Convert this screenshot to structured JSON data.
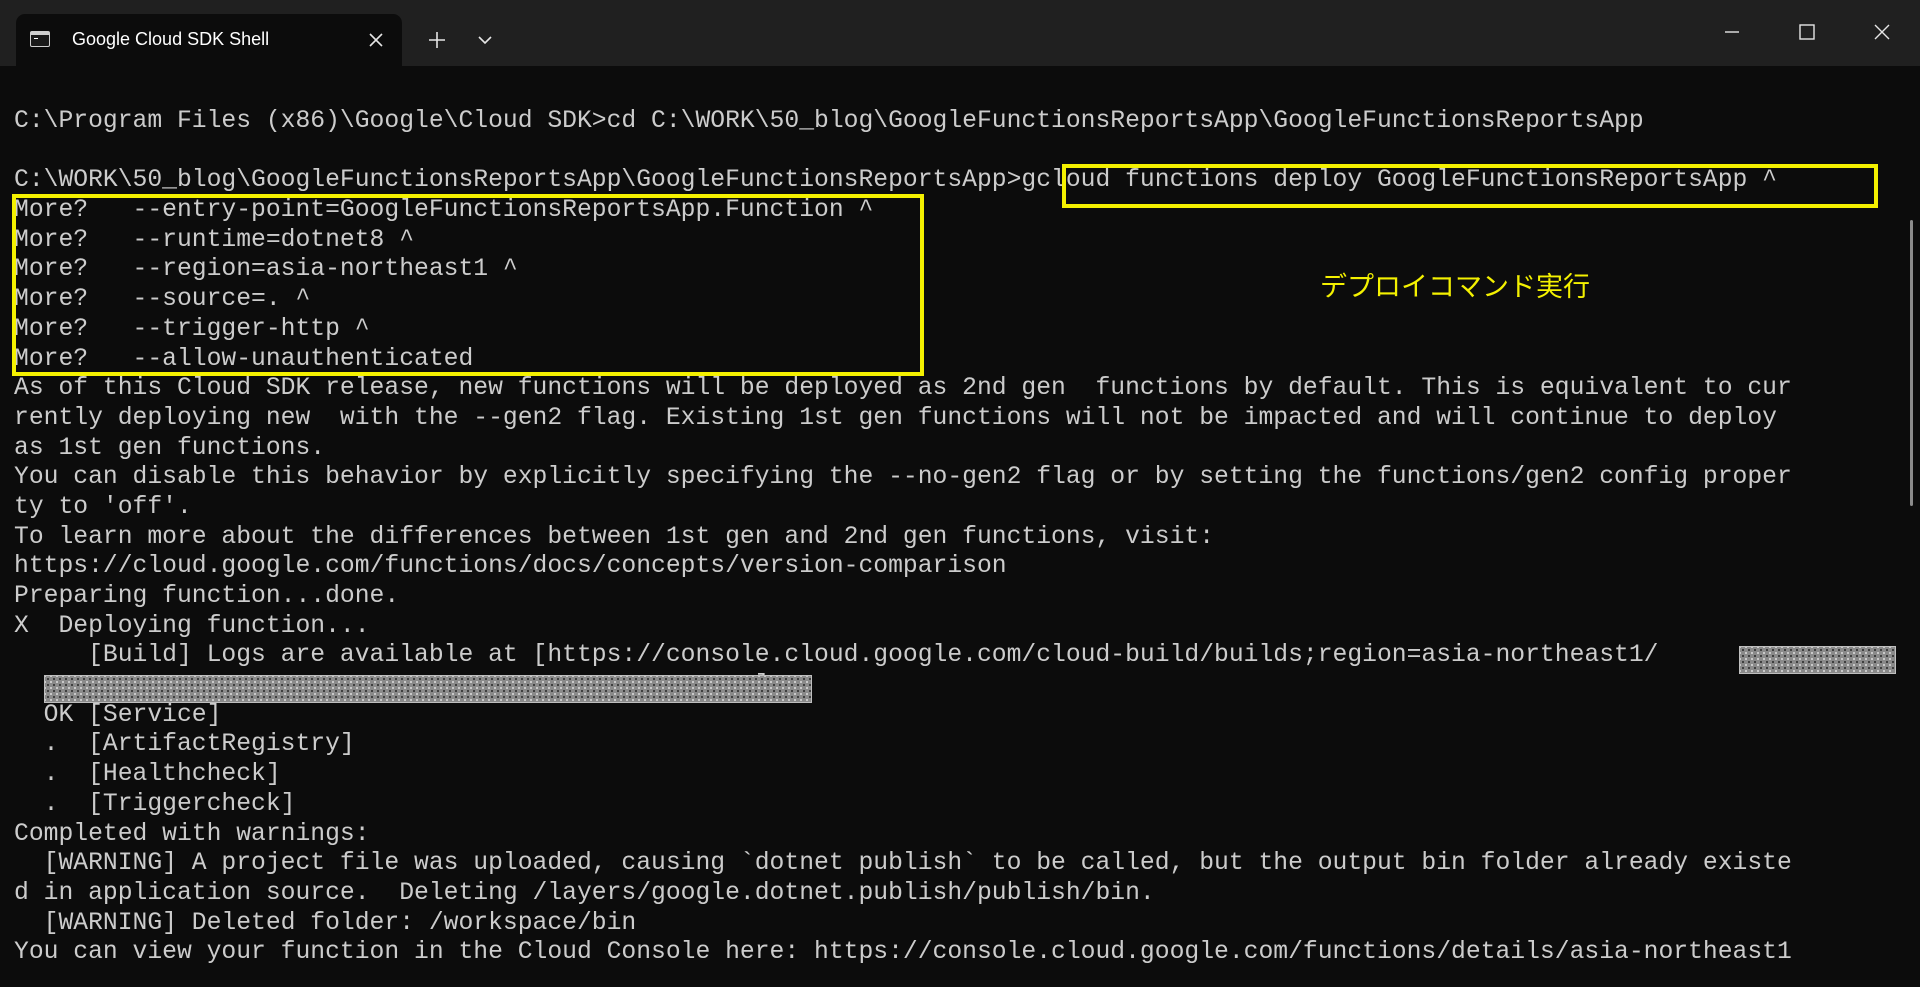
{
  "window": {
    "tab_title": "Google Cloud SDK Shell",
    "tab_icon": "terminal-icon",
    "buttons": {
      "close_tab": "close-icon",
      "new_tab": "plus-icon",
      "tab_menu": "chevron-down-icon",
      "minimize": "minimize-icon",
      "maximize": "maximize-icon",
      "close_window": "close-icon"
    }
  },
  "terminal": {
    "lines": [
      "",
      "C:\\Program Files (x86)\\Google\\Cloud SDK>cd C:\\WORK\\50_blog\\GoogleFunctionsReportsApp\\GoogleFunctionsReportsApp",
      "",
      "C:\\WORK\\50_blog\\GoogleFunctionsReportsApp\\GoogleFunctionsReportsApp>gcloud functions deploy GoogleFunctionsReportsApp ^",
      "More?   --entry-point=GoogleFunctionsReportsApp.Function ^",
      "More?   --runtime=dotnet8 ^",
      "More?   --region=asia-northeast1 ^",
      "More?   --source=. ^",
      "More?   --trigger-http ^",
      "More?   --allow-unauthenticated",
      "As of this Cloud SDK release, new functions will be deployed as 2nd gen  functions by default. This is equivalent to cur",
      "rently deploying new  with the --gen2 flag. Existing 1st gen functions will not be impacted and will continue to deploy",
      "as 1st gen functions.",
      "You can disable this behavior by explicitly specifying the --no-gen2 flag or by setting the functions/gen2 config proper",
      "ty to 'off'.",
      "To learn more about the differences between 1st gen and 2nd gen functions, visit:",
      "https://cloud.google.com/functions/docs/concepts/version-comparison",
      "Preparing function...done.",
      "X  Deploying function...",
      "     [Build] Logs are available at [https://console.cloud.google.com/cloud-build/builds;region=asia-northeast1/",
      "                                                  ]",
      "  OK [Service]",
      "  .  [ArtifactRegistry]",
      "  .  [Healthcheck]",
      "  .  [Triggercheck]",
      "Completed with warnings:",
      "  [WARNING] A project file was uploaded, causing `dotnet publish` to be called, but the output bin folder already existe",
      "d in application source.  Deleting /layers/google.dotnet.publish/publish/bin.",
      "  [WARNING] Deleted folder: /workspace/bin",
      "You can view your function in the Cloud Console here: https://console.cloud.google.com/functions/details/asia-northeast1"
    ]
  },
  "annotation": {
    "text": "デプロイコマンド実行",
    "color": "#f4f100"
  },
  "colors": {
    "background": "#0c0c0c",
    "titlebar": "#202020",
    "text": "#cccccc",
    "highlight": "#f4f100"
  }
}
